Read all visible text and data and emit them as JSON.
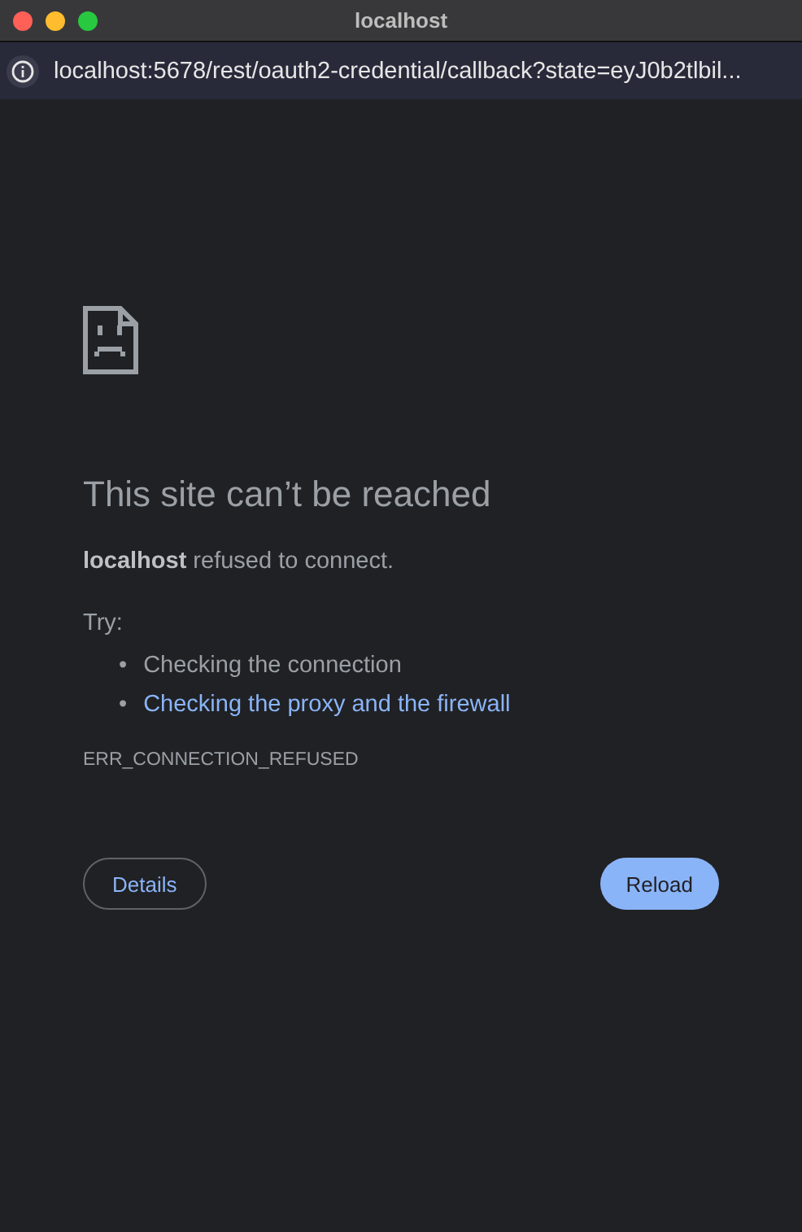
{
  "window": {
    "title": "localhost"
  },
  "address_bar": {
    "url": "localhost:5678/rest/oauth2-credential/callback?state=eyJ0b2tlbil..."
  },
  "error": {
    "title": "This site can’t be reached",
    "message": "**localhost** refused to connect.",
    "try_label": "Try:",
    "suggestions": [
      {
        "bullet": "•",
        "text": "Checking the connection",
        "kind": "text"
      },
      {
        "bullet": "•",
        "text": "Checking the proxy and the firewall",
        "kind": "link"
      }
    ],
    "code": "ERR_CONNECTION_REFUSED"
  },
  "buttons": {
    "details": "Details",
    "reload": "Reload"
  }
}
